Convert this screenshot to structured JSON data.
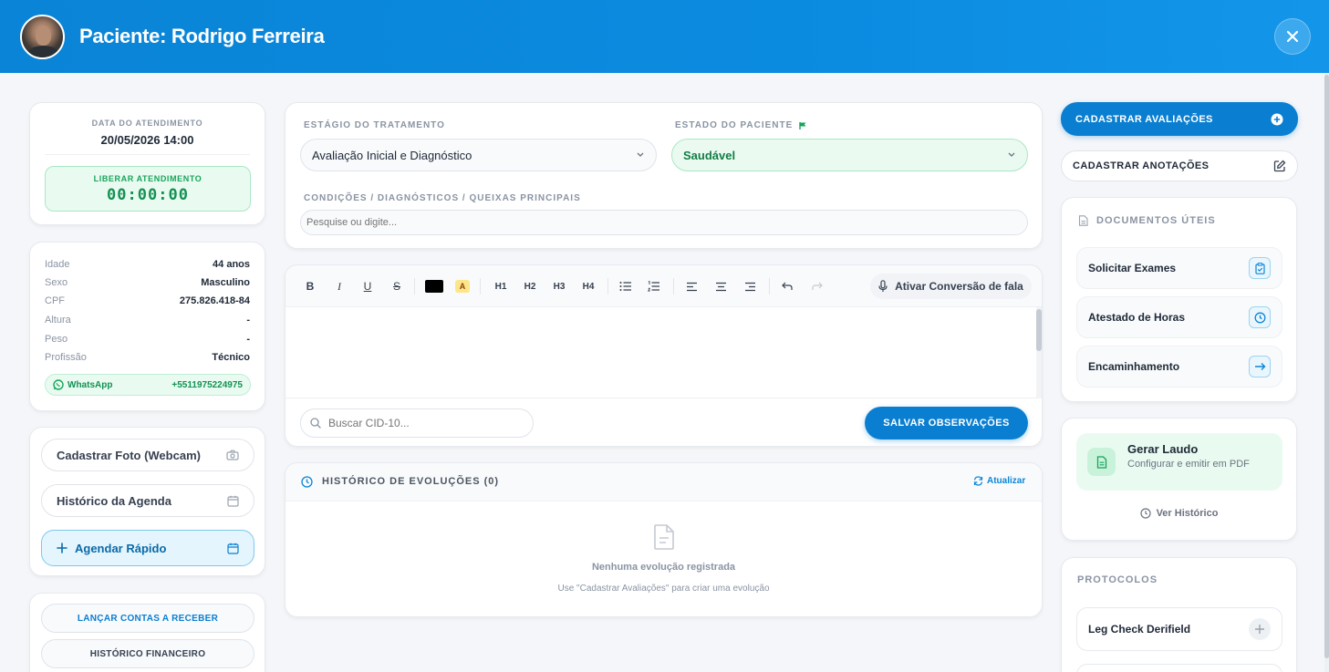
{
  "header": {
    "title": "Paciente: Rodrigo Ferreira"
  },
  "appointment": {
    "date_label": "DATA DO ATENDIMENTO",
    "date_value": "20/05/2026 14:00",
    "release_label": "LIBERAR ATENDIMENTO",
    "timer": "00:00:00"
  },
  "patient_info": [
    {
      "key": "Idade",
      "value": "44 anos"
    },
    {
      "key": "Sexo",
      "value": "Masculino"
    },
    {
      "key": "CPF",
      "value": "275.826.418-84"
    },
    {
      "key": "Altura",
      "value": "-"
    },
    {
      "key": "Peso",
      "value": "-"
    },
    {
      "key": "Profissão",
      "value": "Técnico"
    }
  ],
  "whatsapp": {
    "label": "WhatsApp",
    "number": "+5511975224975"
  },
  "actions": {
    "photo": "Cadastrar Foto (Webcam)",
    "schedule_history": "Histórico da Agenda",
    "quick_schedule": "Agendar Rápido"
  },
  "finance": {
    "receivables": "LANÇAR CONTAS A RECEBER",
    "history": "HISTÓRICO FINANCEIRO"
  },
  "treatment": {
    "stage_label": "ESTÁGIO DO TRATAMENTO",
    "stage_value": "Avaliação Inicial e Diagnóstico",
    "state_label": "ESTADO DO PACIENTE",
    "state_value": "Saudável",
    "conditions_label": "CONDIÇÕES / DIAGNÓSTICOS / QUEIXAS PRINCIPAIS",
    "conditions_placeholder": "Pesquise ou digite..."
  },
  "editor": {
    "toolbar": {
      "bold": "B",
      "italic": "I",
      "underline": "U",
      "strike": "S",
      "highlight": "A",
      "h1": "H1",
      "h2": "H2",
      "h3": "H3",
      "h4": "H4"
    },
    "speech_label": "Ativar Conversão de fala",
    "cid_placeholder": "Buscar CID-10...",
    "save_label": "SALVAR OBSERVAÇÕES"
  },
  "history": {
    "title": "HISTÓRICO DE EVOLUÇÕES (0)",
    "refresh": "Atualizar",
    "empty_title": "Nenhuma evolução registrada",
    "empty_sub": "Use \"Cadastrar Avaliações\" para criar uma evolução"
  },
  "right": {
    "register_evaluations": "CADASTRAR AVALIAÇÕES",
    "register_notes": "CADASTRAR ANOTAÇÕES",
    "documents_title": "DOCUMENTOS ÚTEIS",
    "documents": [
      {
        "label": "Solicitar Exames",
        "icon": "clipboard-icon"
      },
      {
        "label": "Atestado de Horas",
        "icon": "clock-icon"
      },
      {
        "label": "Encaminhamento",
        "icon": "arrow-right-icon"
      }
    ],
    "report_title": "Gerar Laudo",
    "report_sub": "Configurar e emitir em PDF",
    "view_history": "Ver Histórico",
    "protocols_title": "PROTOCOLOS",
    "protocols": [
      {
        "label": "Leg Check Derifield"
      }
    ]
  },
  "colors": {
    "primary": "#0a7fd1",
    "header": "#0b8be0",
    "success": "#17a45a",
    "success_bg": "#e9fbf1"
  }
}
